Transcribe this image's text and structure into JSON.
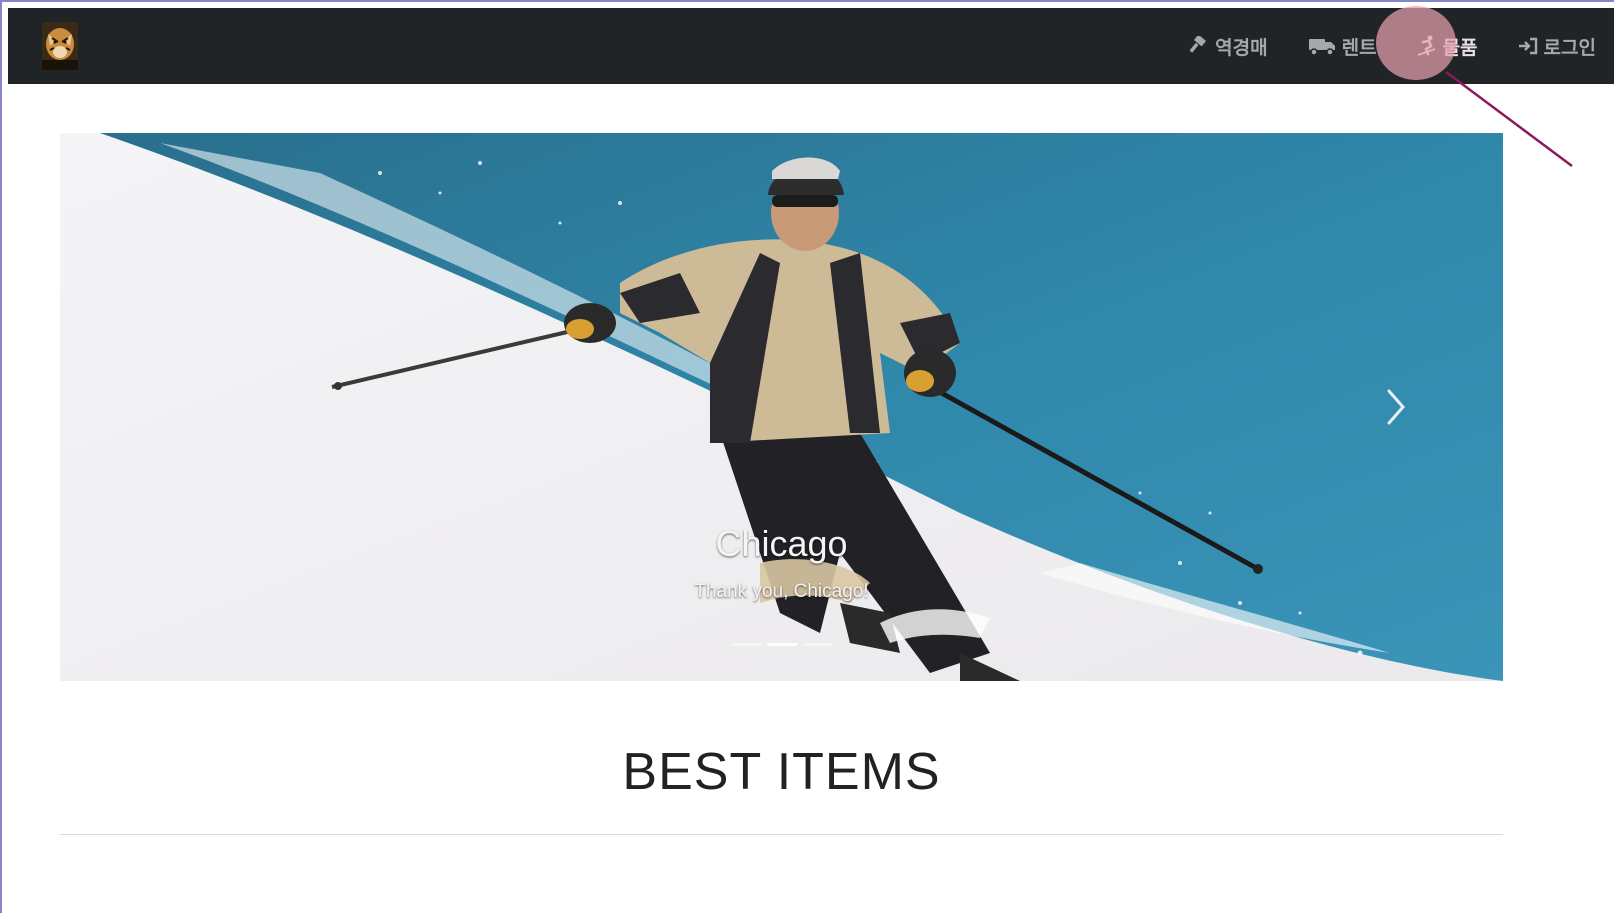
{
  "navbar": {
    "brand_icon": "tiger-logo-icon",
    "items": [
      {
        "label": "역경매",
        "icon": "gavel-icon"
      },
      {
        "label": "렌트",
        "icon": "truck-icon"
      },
      {
        "label": "물품",
        "icon": "skier-icon"
      },
      {
        "label": "로그인",
        "icon": "sign-in-icon"
      }
    ]
  },
  "carousel": {
    "caption_title": "Chicago",
    "caption_text": "Thank you, Chicago!",
    "slide_count": 3,
    "active_slide": 2,
    "next_icon": "chevron-right-icon"
  },
  "section": {
    "title": "BEST ITEMS"
  },
  "colors": {
    "navbar_bg": "#212426",
    "nav_text": "#a6a8ab",
    "highlight": "#e6a0af",
    "annotation_line": "#8b1a5c"
  }
}
